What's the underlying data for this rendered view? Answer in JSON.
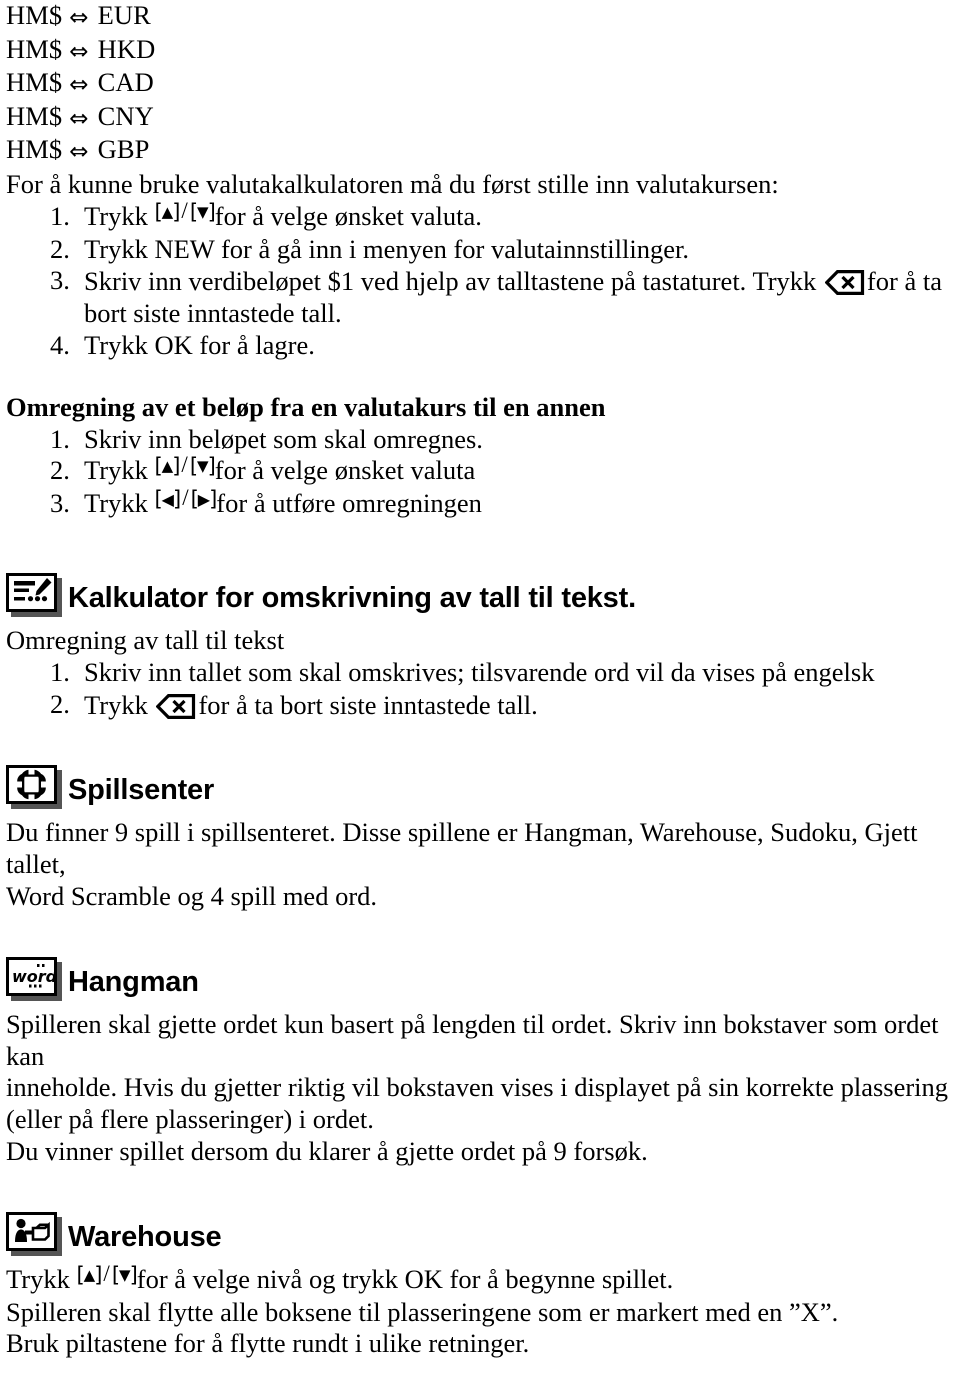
{
  "currency_pairs": [
    {
      "from": "HM$",
      "arrow": "double-arrow-icon",
      "to": "EUR"
    },
    {
      "from": "HM$",
      "arrow": "double-arrow-icon",
      "to": "HKD"
    },
    {
      "from": "HM$",
      "arrow": "double-arrow-icon",
      "to": "CAD"
    },
    {
      "from": "HM$",
      "arrow": "double-arrow-icon",
      "to": "CNY"
    },
    {
      "from": "HM$",
      "arrow": "double-arrow-icon",
      "to": "GBP"
    }
  ],
  "currency_setup": {
    "intro": "For å kunne bruke valutakalkulatoren må du først stille inn valutakursen:",
    "steps": [
      {
        "num": "1.",
        "lead": "Trykk",
        "keys": "up-down-arrow-keys",
        "tail": "for å velge ønsket valuta."
      },
      {
        "num": "2.",
        "lead": "Trykk NEW for å gå inn i menyen for valutainnstillinger.",
        "keys": "",
        "tail": ""
      },
      {
        "num": "3.",
        "lead": "Skriv inn verdibeløpet $1 ved hjelp av talltastene på tastaturet. Trykk",
        "keys": "backspace-key",
        "tail": "for å ta bort siste inntastede tall."
      },
      {
        "num": "4.",
        "lead": "Trykk OK for å lagre.",
        "keys": "",
        "tail": ""
      }
    ]
  },
  "conversion": {
    "heading": "Omregning av et beløp fra en valutakurs til en annen",
    "steps": [
      {
        "num": "1.",
        "lead": "Skriv inn beløpet som skal omregnes.",
        "keys": "",
        "tail": ""
      },
      {
        "num": "2.",
        "lead": "Trykk",
        "keys": "up-down-arrow-keys",
        "tail": "for å velge ønsket valuta"
      },
      {
        "num": "3.",
        "lead": "Trykk",
        "keys": "left-right-arrow-keys",
        "tail": "for å utføre omregningen"
      }
    ]
  },
  "number_to_text": {
    "icon": "calculator-text-icon",
    "heading": "Kalkulator for omskrivning av tall til tekst.",
    "subheading": "Omregning av tall til tekst",
    "steps": [
      {
        "num": "1.",
        "lead": "Skriv inn tallet som skal omskrives; tilsvarende ord vil da vises på engelsk",
        "keys": "",
        "tail": ""
      },
      {
        "num": "2.",
        "lead": "Trykk",
        "keys": "backspace-key",
        "tail": "for å ta bort siste inntastede tall."
      }
    ]
  },
  "game_center": {
    "icon": "game-center-icon",
    "heading": "Spillsenter",
    "body_lines": [
      "Du finner 9 spill i spillsenteret. Disse spillene er Hangman, Warehouse, Sudoku, Gjett tallet,",
      "Word Scramble og 4 spill med ord."
    ]
  },
  "hangman": {
    "icon": "word-icon",
    "icon_label": "word",
    "heading": "Hangman",
    "body_lines": [
      "Spilleren skal gjette ordet kun basert på lengden til ordet. Skriv inn bokstaver som ordet kan",
      "inneholde. Hvis du gjetter riktig vil bokstaven vises i displayet på sin korrekte plassering",
      "(eller på flere plasseringer) i ordet.",
      "Du vinner spillet dersom du klarer å gjette ordet på 9 forsøk."
    ]
  },
  "warehouse": {
    "icon": "warehouse-push-box-icon",
    "heading": "Warehouse",
    "instruction_lead": "Trykk",
    "instruction_keys": "up-down-arrow-keys",
    "instruction_tail": "for å velge nivå og trykk OK for å begynne spillet.",
    "body_lines": [
      "Spilleren skal flytte alle boksene til plasseringene som er markert med en ”X”.",
      "Bruk piltastene for å flytte rundt i ulike retninger."
    ]
  },
  "glyphs": {
    "arrow_double": "⇔",
    "bracket_left": "[",
    "bracket_right": "]",
    "triangle_up": "▲",
    "triangle_down": "▼",
    "triangle_left": "◀",
    "triangle_right": "▶",
    "slash": "/"
  },
  "colors": {
    "text": "#000000",
    "background": "#ffffff",
    "icon_shadow": "#555555"
  }
}
